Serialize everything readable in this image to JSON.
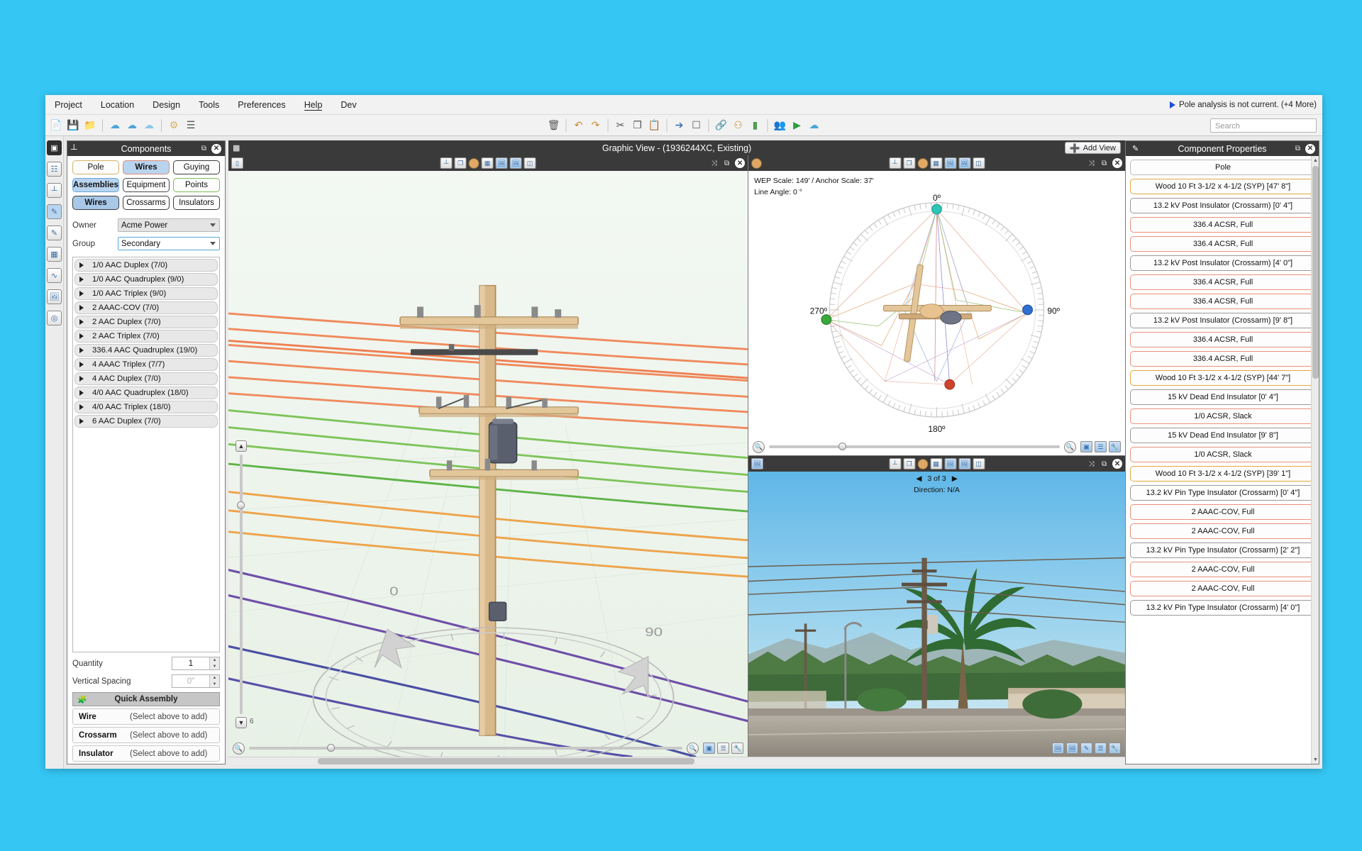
{
  "menu": {
    "items": [
      "Project",
      "Location",
      "Design",
      "Tools",
      "Preferences",
      "Help",
      "Dev"
    ],
    "warning": "Pole analysis is not current. (+4 More)"
  },
  "toolbar": {
    "search_placeholder": "Search",
    "icons_left": [
      "new-document-icon",
      "save-icon",
      "folder-open-icon",
      "cloud-upload-icon",
      "cloud-download-icon",
      "cloud-info-icon",
      "settings-icon",
      "list-icon"
    ],
    "icons_center": [
      "delete-icon",
      "undo-icon",
      "redo-icon",
      "cut-icon",
      "copy-icon",
      "paste-icon",
      "select-icon",
      "frame-icon",
      "link-icon",
      "magnet-icon",
      "battery-icon",
      "people-icon",
      "play-icon",
      "cloud-run-icon"
    ]
  },
  "rail": {
    "items": [
      "grid-icon",
      "layers-icon",
      "pole-icon",
      "pencil-icon",
      "edit-icon",
      "table-icon",
      "wires-icon",
      "image-icon",
      "target-icon"
    ]
  },
  "components": {
    "title": "Components",
    "icon": "pole-icon",
    "tabs_row1": [
      {
        "label": "Pole",
        "style": "pole",
        "selected": false
      },
      {
        "label": "Wires",
        "style": "wires",
        "selected": true
      },
      {
        "label": "Guying",
        "style": "guying",
        "selected": false
      }
    ],
    "tabs_row2": [
      {
        "label": "Assemblies",
        "style": "assemblies",
        "selected": true
      },
      {
        "label": "Equipment",
        "style": "equipment",
        "selected": false
      },
      {
        "label": "Points",
        "style": "points",
        "selected": false
      }
    ],
    "tabs_row3": [
      {
        "label": "Wires",
        "style": "sel2",
        "selected": true
      },
      {
        "label": "Crossarms",
        "style": "guying",
        "selected": false
      },
      {
        "label": "Insulators",
        "style": "guying",
        "selected": false
      }
    ],
    "owner_label": "Owner",
    "owner_value": "Acme Power",
    "group_label": "Group",
    "group_value": "Secondary",
    "wire_items": [
      "1/0 AAC Duplex (7/0)",
      "1/0 AAC Quadruplex (9/0)",
      "1/0 AAC Triplex (9/0)",
      "2 AAAC-COV (7/0)",
      "2 AAC Duplex (7/0)",
      "2 AAC Triplex (7/0)",
      "336.4 AAC Quadruplex (19/0)",
      "4 AAAC Triplex (7/7)",
      "4 AAC Duplex (7/0)",
      "4/0 AAC Quadruplex (18/0)",
      "4/0 AAC Triplex (18/0)",
      "6 AAC Duplex (7/0)"
    ],
    "quantity_label": "Quantity",
    "quantity_value": "1",
    "vertical_spacing_label": "Vertical Spacing",
    "vertical_spacing_value": "0\"",
    "quick_assembly": {
      "title": "Quick Assembly",
      "icon": "puzzle-icon",
      "rows": [
        {
          "label": "Wire",
          "value": "(Select above to add)"
        },
        {
          "label": "Crossarm",
          "value": "(Select above to add)"
        },
        {
          "label": "Insulator",
          "value": "(Select above to add)"
        }
      ]
    }
  },
  "graphic_view": {
    "title": "Graphic View - (1936244XC, Existing)",
    "add_view_label": "Add View"
  },
  "polar_view": {
    "wep_scale": "WEP Scale: 149' / Anchor Scale: 37'",
    "line_angle": "Line Angle: 0 °",
    "deg_top": "0º",
    "deg_right": "90º",
    "deg_bottom": "180º",
    "deg_left": "270º"
  },
  "photo_view": {
    "counter": "3 of 3",
    "direction": "Direction: N/A"
  },
  "model_view": {
    "angle_label_left": "0°",
    "angle_label_right": "90°",
    "scale_value": "6"
  },
  "properties": {
    "title": "Component Properties",
    "icon": "pencil-icon",
    "items": [
      {
        "label": "Pole",
        "style": "pole"
      },
      {
        "label": "Wood 10 Ft 3-1/2 x 4-1/2 (SYP) [47' 8\"]",
        "style": "wood"
      },
      {
        "label": "13.2 kV Post Insulator (Crossarm) [0' 4\"]",
        "style": "ins"
      },
      {
        "label": "336.4 ACSR, Full",
        "style": "wire"
      },
      {
        "label": "336.4 ACSR, Full",
        "style": "wire"
      },
      {
        "label": "13.2 kV Post Insulator (Crossarm) [4' 0\"]",
        "style": "ins"
      },
      {
        "label": "336.4 ACSR, Full",
        "style": "wire"
      },
      {
        "label": "336.4 ACSR, Full",
        "style": "wire"
      },
      {
        "label": "13.2 kV Post Insulator (Crossarm) [9' 8\"]",
        "style": "ins"
      },
      {
        "label": "336.4 ACSR, Full",
        "style": "wire"
      },
      {
        "label": "336.4 ACSR, Full",
        "style": "wire"
      },
      {
        "label": "Wood 10 Ft 3-1/2 x 4-1/2 (SYP) [44' 7\"]",
        "style": "wood"
      },
      {
        "label": "15 kV Dead End Insulator [0' 4\"]",
        "style": "ins"
      },
      {
        "label": "1/0 ACSR, Slack",
        "style": "wire"
      },
      {
        "label": "15 kV Dead End Insulator [9' 8\"]",
        "style": "ins"
      },
      {
        "label": "1/0 ACSR, Slack",
        "style": "wire"
      },
      {
        "label": "Wood 10 Ft 3-1/2 x 4-1/2 (SYP) [39' 1\"]",
        "style": "wood"
      },
      {
        "label": "13.2 kV Pin Type Insulator (Crossarm) [0' 4\"]",
        "style": "ins"
      },
      {
        "label": "2 AAAC-COV, Full",
        "style": "wire"
      },
      {
        "label": "2 AAAC-COV, Full",
        "style": "wire"
      },
      {
        "label": "13.2 kV Pin Type Insulator (Crossarm) [2' 2\"]",
        "style": "ins"
      },
      {
        "label": "2 AAAC-COV, Full",
        "style": "wire"
      },
      {
        "label": "2 AAAC-COV, Full",
        "style": "wire"
      },
      {
        "label": "13.2 kV Pin Type Insulator (Crossarm) [4' 0\"]",
        "style": "ins"
      }
    ]
  },
  "colors": {
    "desktop": "#35c6f4",
    "panel_header": "#3a3a3a",
    "accent_blue": "#b9d4ef",
    "wire_orange": "#e8917c",
    "wood_gold": "#e0a83c"
  }
}
